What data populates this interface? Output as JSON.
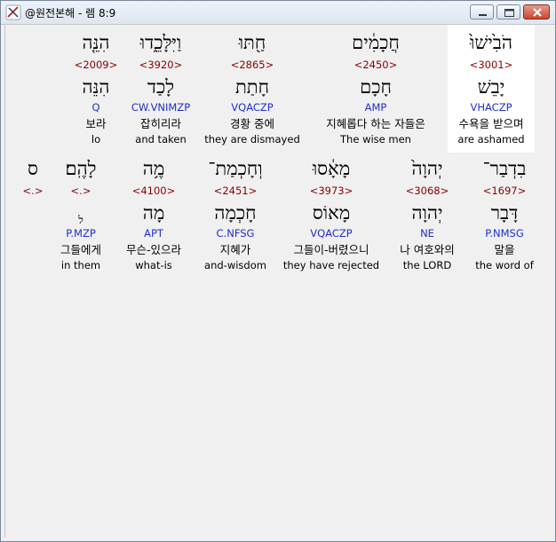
{
  "window": {
    "title": "@원전본해 - 렘 8:9",
    "icons": {
      "app": "bible-app-icon",
      "minimize": "minimize-icon",
      "maximize": "maximize-icon",
      "close": "close-icon"
    }
  },
  "colors": {
    "strong": "#8b0000",
    "parse": "#1f2fc8",
    "text": "#000000",
    "highlight": "#ffffff"
  },
  "words": [
    {
      "heb": "הֹבִ֙ישׁוּ֙",
      "strong": "<3001>",
      "lex": "יָבֵשׁ",
      "parse": "VHACZP",
      "kor": "수욕을 받으며",
      "eng": "are ashamed",
      "highlighted": true
    },
    {
      "heb": "חֲכָמִ֔ים",
      "strong": "<2450>",
      "lex": "חָכָם",
      "parse": "AMP",
      "kor": "지혜롭다 하는 자들은",
      "eng": "The wise men",
      "highlighted": false
    },
    {
      "heb": "חַ֖תּוּ",
      "strong": "<2865>",
      "lex": "חָתַת",
      "parse": "VQACZP",
      "kor": "경황 중에",
      "eng": "they are dismayed",
      "highlighted": false
    },
    {
      "heb": "וַיִּלָּכֵ֑דוּ",
      "strong": "<3920>",
      "lex": "לָכַד",
      "parse": "CW.VNIMZP",
      "kor": "잡히리라",
      "eng": "and taken",
      "highlighted": false
    },
    {
      "heb": "הִנֵּ֤ה",
      "strong": "<2009>",
      "lex": "הִנֵּה",
      "parse": "Q",
      "kor": "보라",
      "eng": "lo",
      "highlighted": false
    },
    {
      "heb": "בִדְבַר־",
      "strong": "<1697>",
      "lex": "דָּבָר",
      "parse": "P.NMSG",
      "kor": "말을",
      "eng": "the word of",
      "highlighted": false
    },
    {
      "heb": "יְהוָה֙",
      "strong": "<3068>",
      "lex": "יְהוָה",
      "parse": "NE",
      "kor": "나 여호와의",
      "eng": "the LORD",
      "highlighted": false
    },
    {
      "heb": "מָאָ֔סוּ",
      "strong": "<3973>",
      "lex": "מָאוֹס",
      "parse": "VQACZP",
      "kor": "그들이-버렸으니",
      "eng": "they have rejected",
      "highlighted": false
    },
    {
      "heb": "וְחָכְמַת־",
      "strong": "<2451>",
      "lex": "חָכְמָה",
      "parse": "C.NFSG",
      "kor": "지혜가",
      "eng": "and-wisdom",
      "highlighted": false
    },
    {
      "heb": "מֶ֥ה",
      "strong": "<4100>",
      "lex": "מָה",
      "parse": "APT",
      "kor": "무슨-있으라",
      "eng": "what-is",
      "highlighted": false
    },
    {
      "heb": "לָהֶֽם׃",
      "strong": "<.>",
      "lex": "ל",
      "parse": "P.MZP",
      "kor": "그들에게",
      "eng": "in them",
      "highlighted": false
    },
    {
      "heb": "ס",
      "strong": "<.>",
      "lex": "",
      "parse": "",
      "kor": "",
      "eng": "",
      "highlighted": false
    }
  ]
}
